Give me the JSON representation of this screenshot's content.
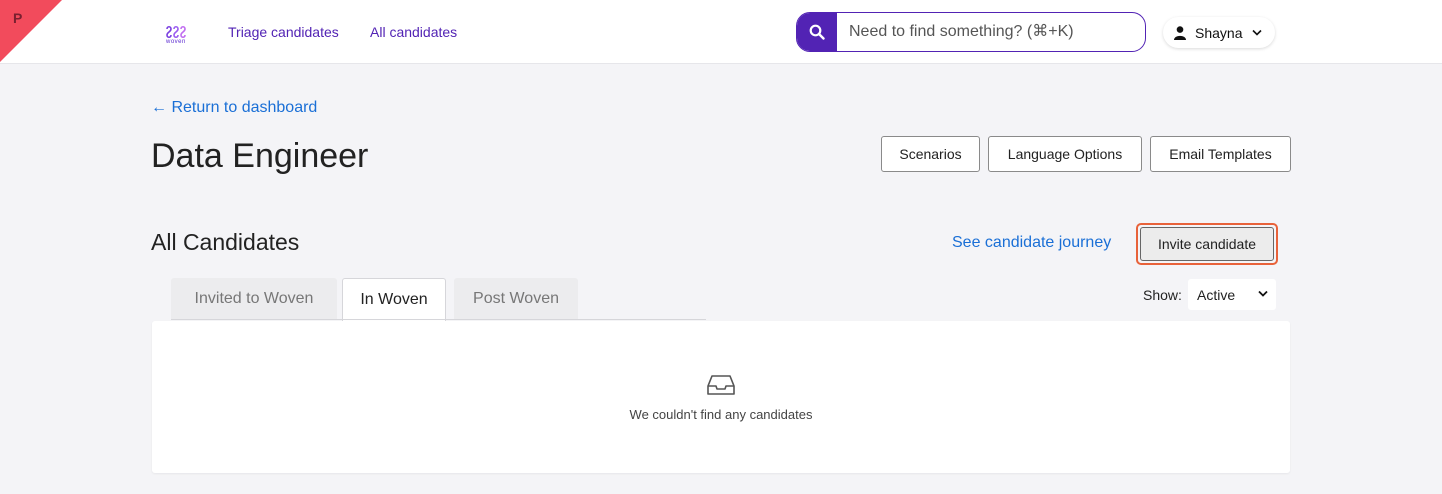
{
  "corner_badge": {
    "letter": "P"
  },
  "brand": {
    "logo_text": "woven"
  },
  "nav": [
    {
      "label": "Triage candidates"
    },
    {
      "label": "All candidates"
    }
  ],
  "search": {
    "placeholder": "Need to find something? (⌘+K)"
  },
  "user": {
    "name": "Shayna"
  },
  "main": {
    "return_link": "← Return to dashboard",
    "title": "Data Engineer",
    "actions": [
      {
        "label": "Scenarios"
      },
      {
        "label": "Language Options"
      },
      {
        "label": "Email Templates"
      }
    ],
    "section_title": "All Candidates",
    "journey_link": "See candidate journey",
    "invite_label": "Invite candidate",
    "tabs": [
      {
        "label": "Invited to Woven",
        "active": false
      },
      {
        "label": "In Woven",
        "active": true
      },
      {
        "label": "Post Woven",
        "active": false
      }
    ],
    "show_label": "Show:",
    "show_value": "Active",
    "empty_message": "We couldn't find any candidates"
  },
  "colors": {
    "brand_purple": "#5223b4",
    "link_blue": "#1a6fd6",
    "focus_orange": "#e8623a",
    "corner_red": "#f24b5c"
  }
}
